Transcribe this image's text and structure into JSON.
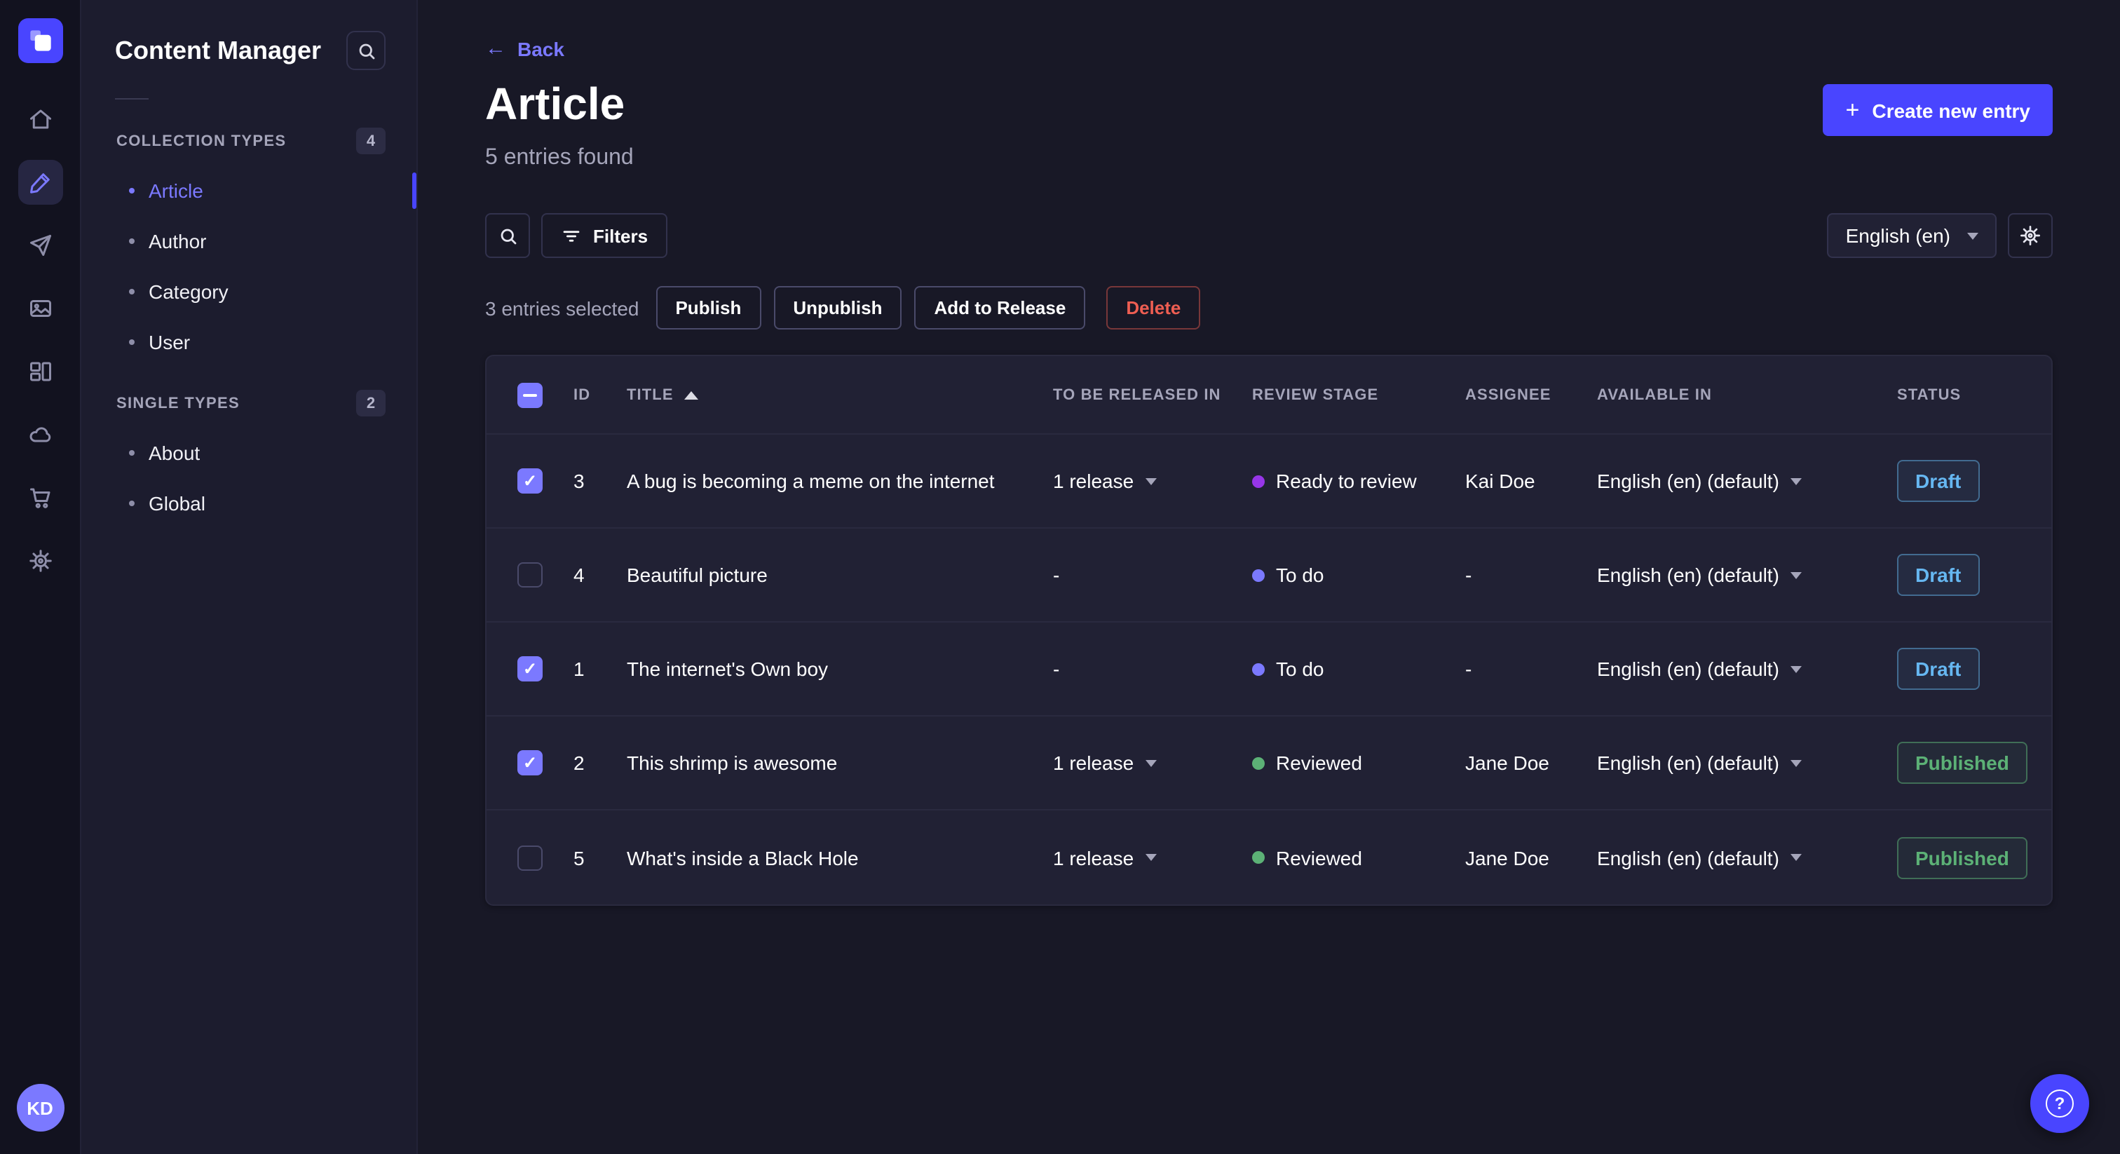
{
  "colors": {
    "accent": "#4945ff",
    "link": "#7b79ff",
    "draft": "#66b7f1",
    "published": "#5cb176"
  },
  "icons": {
    "check": "✓",
    "plus": "+",
    "back_arrow": "←",
    "question": "?"
  },
  "rail": {
    "logo": "strapi-logo",
    "icon_names": [
      "home-icon",
      "content-manager-icon",
      "paper-plane-icon",
      "media-library-icon",
      "content-type-builder-icon",
      "cloud-icon",
      "cart-icon",
      "gear-icon"
    ],
    "active_icon": "content-manager-icon",
    "avatar": "KD"
  },
  "sidebar": {
    "title": "Content Manager",
    "sections": [
      {
        "label": "COLLECTION TYPES",
        "badge": "4",
        "items": [
          {
            "label": "Article",
            "active": true
          },
          {
            "label": "Author",
            "active": false
          },
          {
            "label": "Category",
            "active": false
          },
          {
            "label": "User",
            "active": false
          }
        ]
      },
      {
        "label": "SINGLE TYPES",
        "badge": "2",
        "items": [
          {
            "label": "About",
            "active": false
          },
          {
            "label": "Global",
            "active": false
          }
        ]
      }
    ]
  },
  "header": {
    "back": "Back",
    "title": "Article",
    "subtitle": "5 entries found",
    "create_button": "Create new entry"
  },
  "toolbar": {
    "filters": "Filters",
    "locale": "English (en)"
  },
  "selection": {
    "count_label": "3 entries selected",
    "publish": "Publish",
    "unpublish": "Unpublish",
    "add_to_release": "Add to Release",
    "delete": "Delete"
  },
  "table": {
    "columns": {
      "id": "ID",
      "title": "TITLE",
      "release": "TO BE RELEASED IN",
      "stage": "REVIEW STAGE",
      "assignee": "ASSIGNEE",
      "available": "AVAILABLE IN",
      "status": "STATUS"
    },
    "stage_colors": {
      "Ready to review": "#9736e8",
      "To do": "#7b79ff",
      "Reviewed": "#5cb176"
    },
    "rows": [
      {
        "selected": true,
        "id": "3",
        "title": "A bug is becoming a meme on the internet",
        "release": "1 release",
        "stage": "Ready to review",
        "assignee": "Kai Doe",
        "available": "English (en) (default)",
        "status": "Draft"
      },
      {
        "selected": false,
        "id": "4",
        "title": "Beautiful picture",
        "release": "-",
        "stage": "To do",
        "assignee": "-",
        "available": "English (en) (default)",
        "status": "Draft"
      },
      {
        "selected": true,
        "id": "1",
        "title": "The internet's Own boy",
        "release": "-",
        "stage": "To do",
        "assignee": "-",
        "available": "English (en) (default)",
        "status": "Draft"
      },
      {
        "selected": true,
        "id": "2",
        "title": "This shrimp is awesome",
        "release": "1 release",
        "stage": "Reviewed",
        "assignee": "Jane Doe",
        "available": "English (en) (default)",
        "status": "Published"
      },
      {
        "selected": false,
        "id": "5",
        "title": "What's inside a Black Hole",
        "release": "1 release",
        "stage": "Reviewed",
        "assignee": "Jane Doe",
        "available": "English (en) (default)",
        "status": "Published"
      }
    ]
  }
}
